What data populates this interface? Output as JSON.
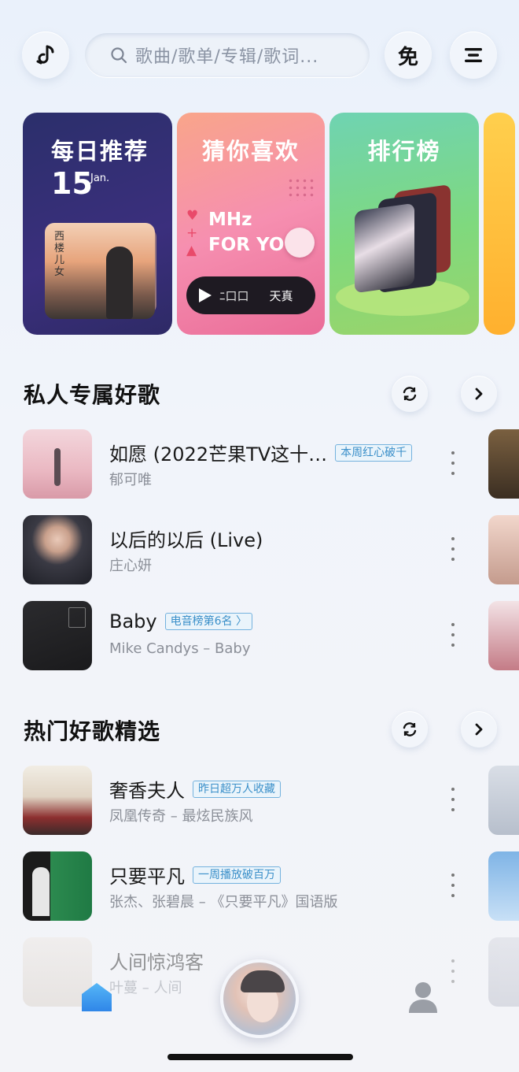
{
  "header": {
    "search_placeholder": "歌曲/歌单/专辑/歌词...",
    "free_label": "免"
  },
  "cards": [
    {
      "title": "每日推荐",
      "date_day": "15",
      "date_month": "Jan.",
      "album_text": "西楼儿女"
    },
    {
      "title": "猜你喜欢",
      "mhz": "MHz",
      "for_you": "FOR YOU",
      "player_left": "ﾆ口口",
      "player_right": "天真"
    },
    {
      "title": "排行榜"
    }
  ],
  "private_section": {
    "title": "私人专属好歌",
    "songs": [
      {
        "title": "如愿 (2022芒果TV这十…",
        "badge": "本周红心破千",
        "artist": "郁可唯"
      },
      {
        "title": "以后的以后 (Live)",
        "badge": "",
        "artist": "庄心妍"
      },
      {
        "title": "Baby",
        "badge": "电音榜第6名 〉",
        "artist": "Mike Candys – Baby"
      }
    ]
  },
  "hot_section": {
    "title": "热门好歌精选",
    "songs": [
      {
        "title": "奢香夫人",
        "badge": "昨日超万人收藏",
        "artist": "凤凰传奇 – 最炫民族风"
      },
      {
        "title": "只要平凡",
        "badge": "一周播放破百万",
        "artist": "张杰、张碧晨 – 《只要平凡》国语版"
      },
      {
        "title": "人间惊鸿客",
        "badge": "",
        "artist": "叶蔓 – 人间"
      }
    ]
  },
  "colors": {
    "accent_blue": "#3a8fc9",
    "card_daily": "#2b2f6b",
    "card_guess": "#f68fb0",
    "card_rank": "#7fd97e",
    "card_extra": "#ffb02e"
  },
  "icons": {
    "logo": "music-note-logo-icon",
    "search": "search-icon",
    "menu": "menu-icon",
    "refresh": "refresh-icon",
    "chevron": "chevron-right-icon",
    "more": "more-vertical-icon",
    "home": "home-icon",
    "user": "user-icon"
  }
}
